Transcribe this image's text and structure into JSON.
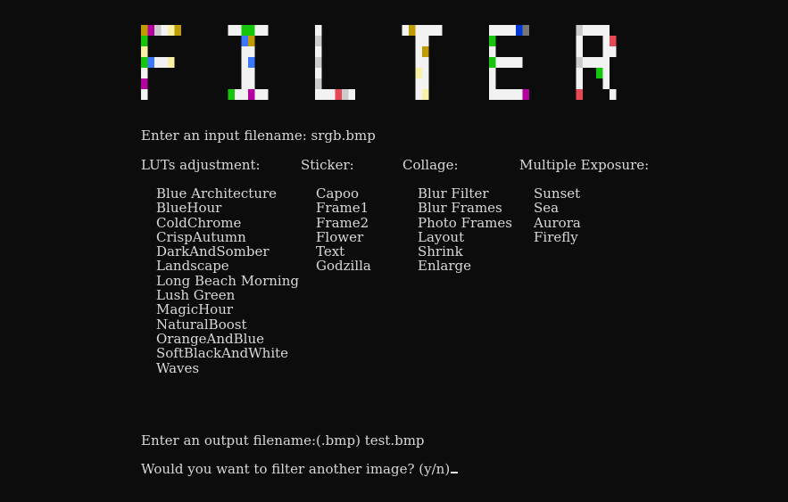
{
  "banner": {
    "text": "FILTER",
    "colors": {
      "white": "#f2f2f2",
      "green": "#16c60c",
      "blue": "#3b78ff",
      "purple": "#b4009e",
      "red": "#e74856",
      "gold": "#c19c00",
      "cyan": "#61d6d6",
      "grey": "#767676",
      "silver": "#cccccc",
      "cream": "#f9f1a5",
      "navy": "#0037da"
    }
  },
  "prompts": {
    "input": "Enter an input filename: srgb.bmp",
    "output": "Enter an output filename:(.bmp) test.bmp",
    "again": "Would you want to filter another image? (y/n)"
  },
  "columns": [
    {
      "header": "LUTs adjustment:",
      "items": [
        "Blue Architecture",
        "BlueHour",
        "ColdChrome",
        "CrispAutumn",
        "DarkAndSomber",
        "Landscape",
        "Long Beach Morning",
        "Lush Green",
        "MagicHour",
        "NaturalBoost",
        "OrangeAndBlue",
        "SoftBlackAndWhite",
        "Waves"
      ]
    },
    {
      "header": "Sticker:",
      "items": [
        "Capoo",
        "Frame1",
        "Frame2",
        "Flower",
        "Text",
        "Godzilla"
      ]
    },
    {
      "header": "Collage:",
      "items": [
        "Blur Filter",
        "Blur Frames",
        "Photo Frames",
        "Layout",
        "Shrink",
        "Enlarge"
      ]
    },
    {
      "header": "Multiple Exposure:",
      "items": [
        "Sunset",
        "Sea",
        "Aurora",
        "Firefly"
      ]
    }
  ]
}
